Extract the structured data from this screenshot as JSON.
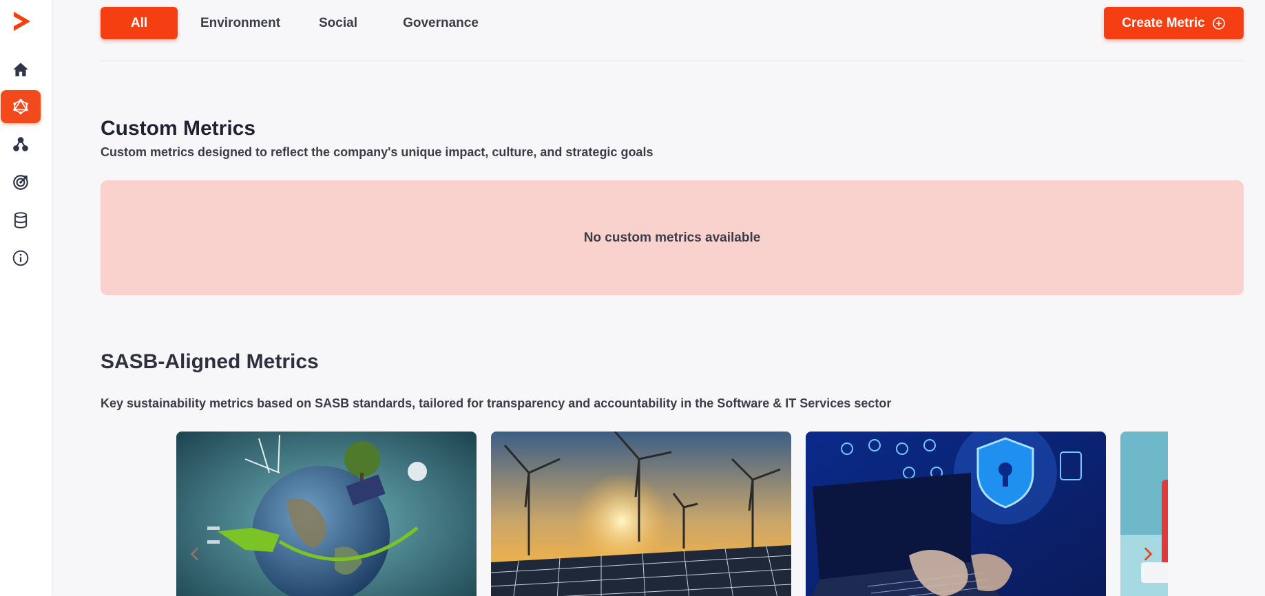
{
  "sidebar": {
    "logo_icon": "chevron-right-logo",
    "items": [
      {
        "icon": "home-icon",
        "active": false
      },
      {
        "icon": "metrics-icon",
        "active": true
      },
      {
        "icon": "hierarchy-icon",
        "active": false
      },
      {
        "icon": "target-icon",
        "active": false
      },
      {
        "icon": "database-icon",
        "active": false
      },
      {
        "icon": "info-icon",
        "active": false
      }
    ]
  },
  "filters": {
    "tabs": [
      {
        "label": "All",
        "active": true
      },
      {
        "label": "Environment",
        "active": false
      },
      {
        "label": "Social",
        "active": false
      },
      {
        "label": "Governance",
        "active": false
      }
    ],
    "create_label": "Create Metric"
  },
  "custom_metrics": {
    "title": "Custom Metrics",
    "subtitle": "Custom metrics designed to reflect the company's unique impact, culture, and strategic goals",
    "empty_text": "No custom metrics available"
  },
  "sasb_metrics": {
    "title": "SASB-Aligned Metrics",
    "subtitle": "Key sustainability metrics based on SASB standards, tailored for transparency and accountability in the Software & IT Services sector",
    "cards": [
      {
        "image": "earth-energy-image"
      },
      {
        "image": "wind-solar-image"
      },
      {
        "image": "cybersecurity-image"
      },
      {
        "image": "laptop-image"
      }
    ]
  },
  "colors": {
    "accent": "#f53f12",
    "empty_bg": "#f9d1cd",
    "page_bg": "#f7f7f9"
  }
}
